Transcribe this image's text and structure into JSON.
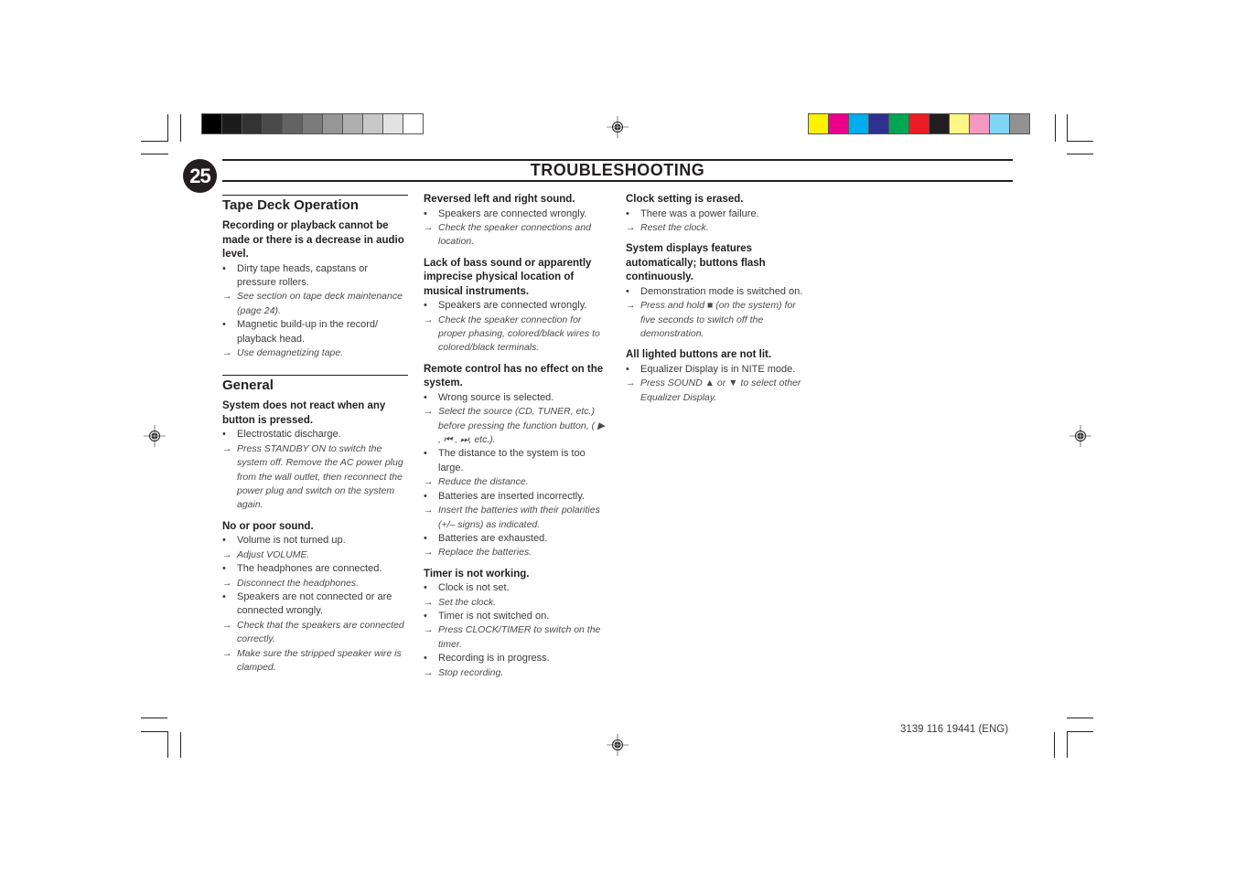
{
  "page": {
    "number": "25",
    "title": "TROUBLESHOOTING",
    "footer_code": "3139 116 19441 (ENG)"
  },
  "print_marks": {
    "gray_swatches": [
      "#000000",
      "#1c1c1c",
      "#333333",
      "#4a4a4a",
      "#636363",
      "#7b7b7b",
      "#969696",
      "#afafaf",
      "#c8c8c8",
      "#e2e2e2",
      "#ffffff"
    ],
    "color_swatches": [
      "#fff200",
      "#ec008c",
      "#00aeef",
      "#2e3192",
      "#00a651",
      "#ed1c24",
      "#231f20",
      "#fff685",
      "#f49ac1",
      "#7fd6f7",
      "#929292"
    ]
  },
  "sections": [
    {
      "heading": "Tape Deck Operation",
      "problems": [
        {
          "title": "Recording or playback cannot be made or there is a decrease in audio level.",
          "items": [
            {
              "type": "cause",
              "text": "Dirty tape heads, capstans or pressure rollers."
            },
            {
              "type": "solution",
              "text": "See section on tape deck maintenance (page 24)."
            },
            {
              "type": "cause",
              "text": "Magnetic build-up in the record/ playback head."
            },
            {
              "type": "solution",
              "text": "Use demagnetizing tape."
            }
          ]
        }
      ]
    },
    {
      "heading": "General",
      "problems": [
        {
          "title": "System does not react when any button is pressed.",
          "items": [
            {
              "type": "cause",
              "text": "Electrostatic discharge."
            },
            {
              "type": "solution",
              "text": "Press STANDBY ON to switch the system off. Remove the AC power plug from the wall outlet, then reconnect the power plug and switch on the system again."
            }
          ]
        },
        {
          "title": "No or poor sound.",
          "items": [
            {
              "type": "cause",
              "text": "Volume is not turned up."
            },
            {
              "type": "solution",
              "text": "Adjust VOLUME."
            },
            {
              "type": "cause",
              "text": "The headphones are connected."
            },
            {
              "type": "solution",
              "text": "Disconnect the headphones."
            },
            {
              "type": "cause",
              "text": "Speakers are not connected or are connected wrongly."
            },
            {
              "type": "solution",
              "text": "Check that the speakers are connected correctly."
            },
            {
              "type": "solution",
              "text": "Make sure the stripped speaker wire is clamped."
            }
          ]
        },
        {
          "title": "Reversed left and right sound.",
          "items": [
            {
              "type": "cause",
              "text": "Speakers are connected wrongly."
            },
            {
              "type": "solution",
              "text": "Check the speaker connections and location."
            }
          ]
        },
        {
          "title": "Lack of bass sound or apparently imprecise physical location of musical instruments.",
          "items": [
            {
              "type": "cause",
              "text": "Speakers are connected wrongly."
            },
            {
              "type": "solution",
              "text": "Check the speaker connection for proper phasing, colored/black wires to colored/black terminals."
            }
          ]
        },
        {
          "title": "Remote control has no effect on the system.",
          "items": [
            {
              "type": "cause",
              "text": "Wrong source is selected."
            },
            {
              "type": "solution",
              "text": "Select the source (CD, TUNER, etc.) before pressing the function button, ( ▶ , ⏮ , ⏭, etc.)."
            },
            {
              "type": "cause",
              "text": "The distance to the system is too large."
            },
            {
              "type": "solution",
              "text": "Reduce the distance."
            },
            {
              "type": "cause",
              "text": "Batteries are inserted incorrectly."
            },
            {
              "type": "solution",
              "text": "Insert the batteries with their polarities (+/– signs) as indicated."
            },
            {
              "type": "cause",
              "text": "Batteries are exhausted."
            },
            {
              "type": "solution",
              "text": "Replace the batteries."
            }
          ]
        },
        {
          "title": "Timer is not working.",
          "items": [
            {
              "type": "cause",
              "text": "Clock is not set."
            },
            {
              "type": "solution",
              "text": "Set the clock."
            },
            {
              "type": "cause",
              "text": "Timer is not switched on."
            },
            {
              "type": "solution",
              "text": "Press CLOCK/TIMER to switch on the timer."
            },
            {
              "type": "cause",
              "text": "Recording is in progress."
            },
            {
              "type": "solution",
              "text": "Stop recording."
            }
          ]
        },
        {
          "title": "Clock setting is erased.",
          "items": [
            {
              "type": "cause",
              "text": "There was a power failure."
            },
            {
              "type": "solution",
              "text": "Reset the clock."
            }
          ]
        },
        {
          "title": "System displays features automatically; buttons flash continuously.",
          "items": [
            {
              "type": "cause",
              "text": "Demonstration mode is switched on."
            },
            {
              "type": "solution",
              "text": "Press and hold ■ (on the system) for five seconds to switch off the demonstration."
            }
          ]
        },
        {
          "title": "All lighted buttons are not lit.",
          "items": [
            {
              "type": "cause",
              "text": "Equalizer Display is in NITE mode."
            },
            {
              "type": "solution",
              "text": "Press SOUND ▲ or ▼ to select other Equalizer Display."
            }
          ]
        }
      ]
    }
  ],
  "markers": {
    "cause": "•",
    "solution": "→"
  }
}
